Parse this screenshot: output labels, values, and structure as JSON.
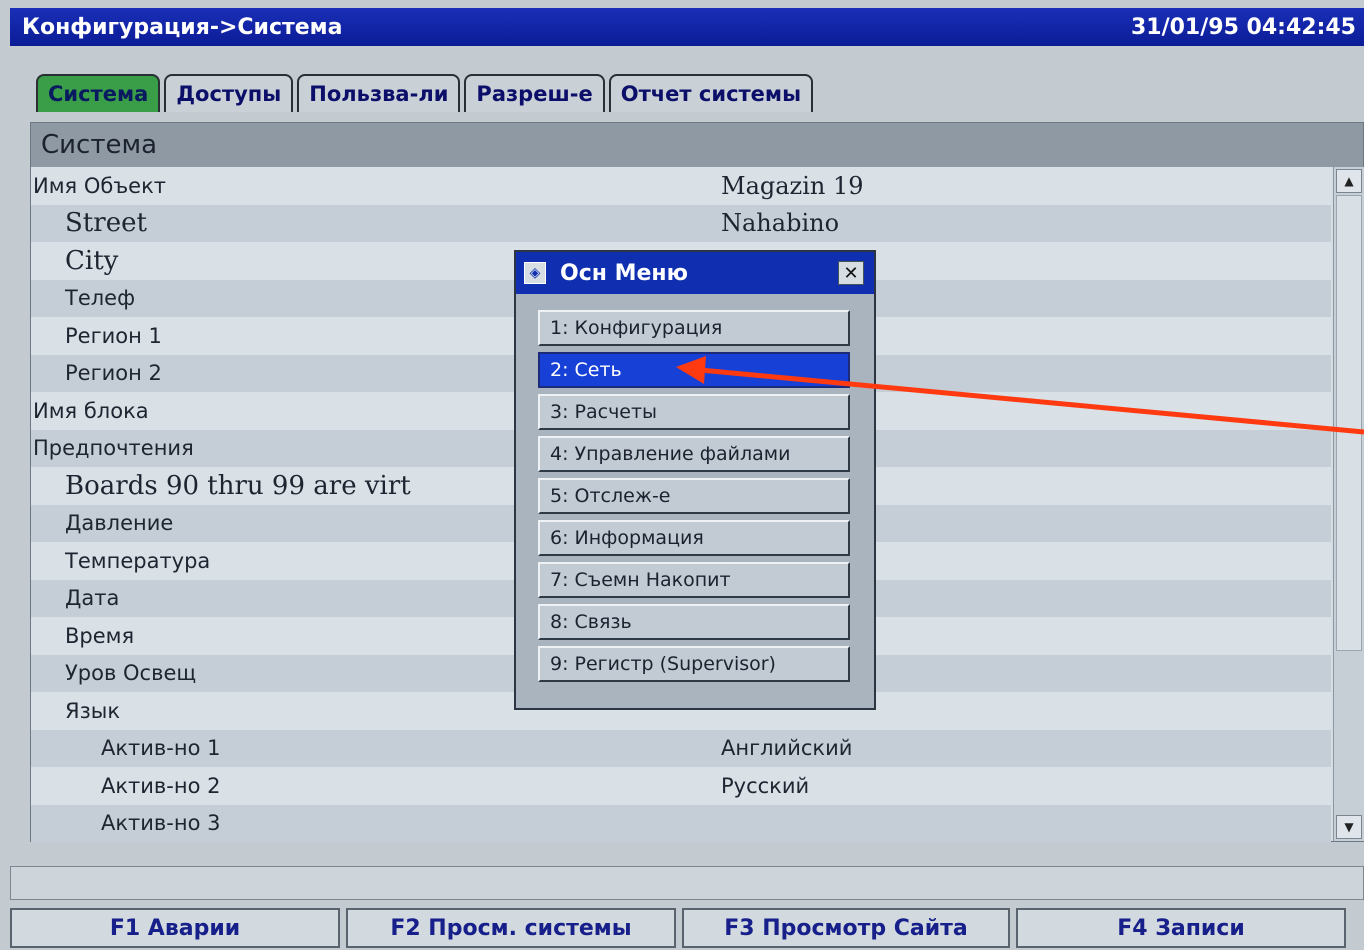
{
  "window": {
    "breadcrumb": "Конфигурация->Система",
    "datetime": "31/01/95 04:42:45"
  },
  "tabs": [
    {
      "label": "Система",
      "active": true
    },
    {
      "label": "Доступы",
      "active": false
    },
    {
      "label": "Пользва-ли",
      "active": false
    },
    {
      "label": "Разреш-е",
      "active": false
    },
    {
      "label": "Отчет системы",
      "active": false
    }
  ],
  "panel": {
    "header": "Система",
    "rows": [
      {
        "label": "Имя Объект",
        "value": "Magazin 19"
      },
      {
        "label": "Street",
        "value": "Nahabino"
      },
      {
        "label": "City",
        "value": ""
      },
      {
        "label": "Телеф",
        "value": ""
      },
      {
        "label": "Регион 1",
        "value": ""
      },
      {
        "label": "Регион 2",
        "value": ""
      },
      {
        "label": "Имя блока",
        "value": ""
      },
      {
        "label": "Предпочтения",
        "value": ""
      },
      {
        "label": "Boards 90 thru 99 are virt",
        "value": ""
      },
      {
        "label": "Давление",
        "value": ""
      },
      {
        "label": "Температура",
        "value": ""
      },
      {
        "label": "Дата",
        "value": ""
      },
      {
        "label": "Время",
        "value": ""
      },
      {
        "label": "Уров Освещ",
        "value": ""
      },
      {
        "label": "Язык",
        "value": ""
      },
      {
        "label": "Актив-но 1",
        "value": "Английский"
      },
      {
        "label": "Актив-но 2",
        "value": "Русский"
      },
      {
        "label": "Актив-но 3",
        "value": ""
      }
    ]
  },
  "main_menu": {
    "title": "Осн Меню",
    "items": [
      {
        "label": "1: Конфигурация",
        "selected": false
      },
      {
        "label": "2: Сеть",
        "selected": true
      },
      {
        "label": "3: Расчеты",
        "selected": false
      },
      {
        "label": "4: Управление файлами",
        "selected": false
      },
      {
        "label": "5: Отслеж-е",
        "selected": false
      },
      {
        "label": "6: Информация",
        "selected": false
      },
      {
        "label": "7: Съемн Накопит",
        "selected": false
      },
      {
        "label": "8: Связь",
        "selected": false
      },
      {
        "label": "9: Регистр (Supervisor)",
        "selected": false
      }
    ]
  },
  "function_keys": [
    {
      "label": "F1 Аварии"
    },
    {
      "label": "F2 Просм. системы"
    },
    {
      "label": "F3 Просмотр Сайта"
    },
    {
      "label": "F4 Записи"
    }
  ],
  "icons": {
    "menu_icon": "app-icon",
    "close": "close-icon",
    "scroll_up": "scroll-up-icon",
    "scroll_down": "scroll-down-icon",
    "annotation": "red-arrow-annotation"
  },
  "colors": {
    "title_bar": "#0b1c96",
    "active_tab": "#3a9e48",
    "selection": "#1740d6",
    "annotation_arrow": "#ff3a10"
  }
}
